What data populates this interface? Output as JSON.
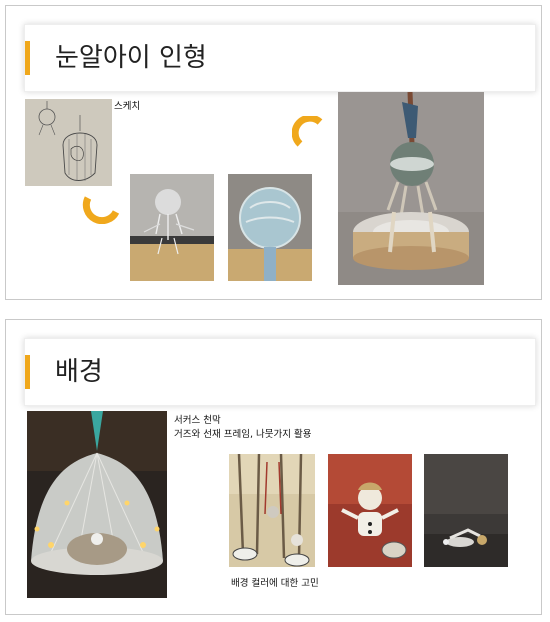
{
  "slides": [
    {
      "title": "눈알아이 인형",
      "sketch_caption": "스케치"
    },
    {
      "title": "배경",
      "caption_line1": "서커스 천막",
      "caption_line2": "거즈와 선재 프레임, 나뭇가지 활용",
      "color_caption": "배경 컬러에 대한 고민"
    }
  ],
  "colors": {
    "accent": "#f0a81c"
  }
}
